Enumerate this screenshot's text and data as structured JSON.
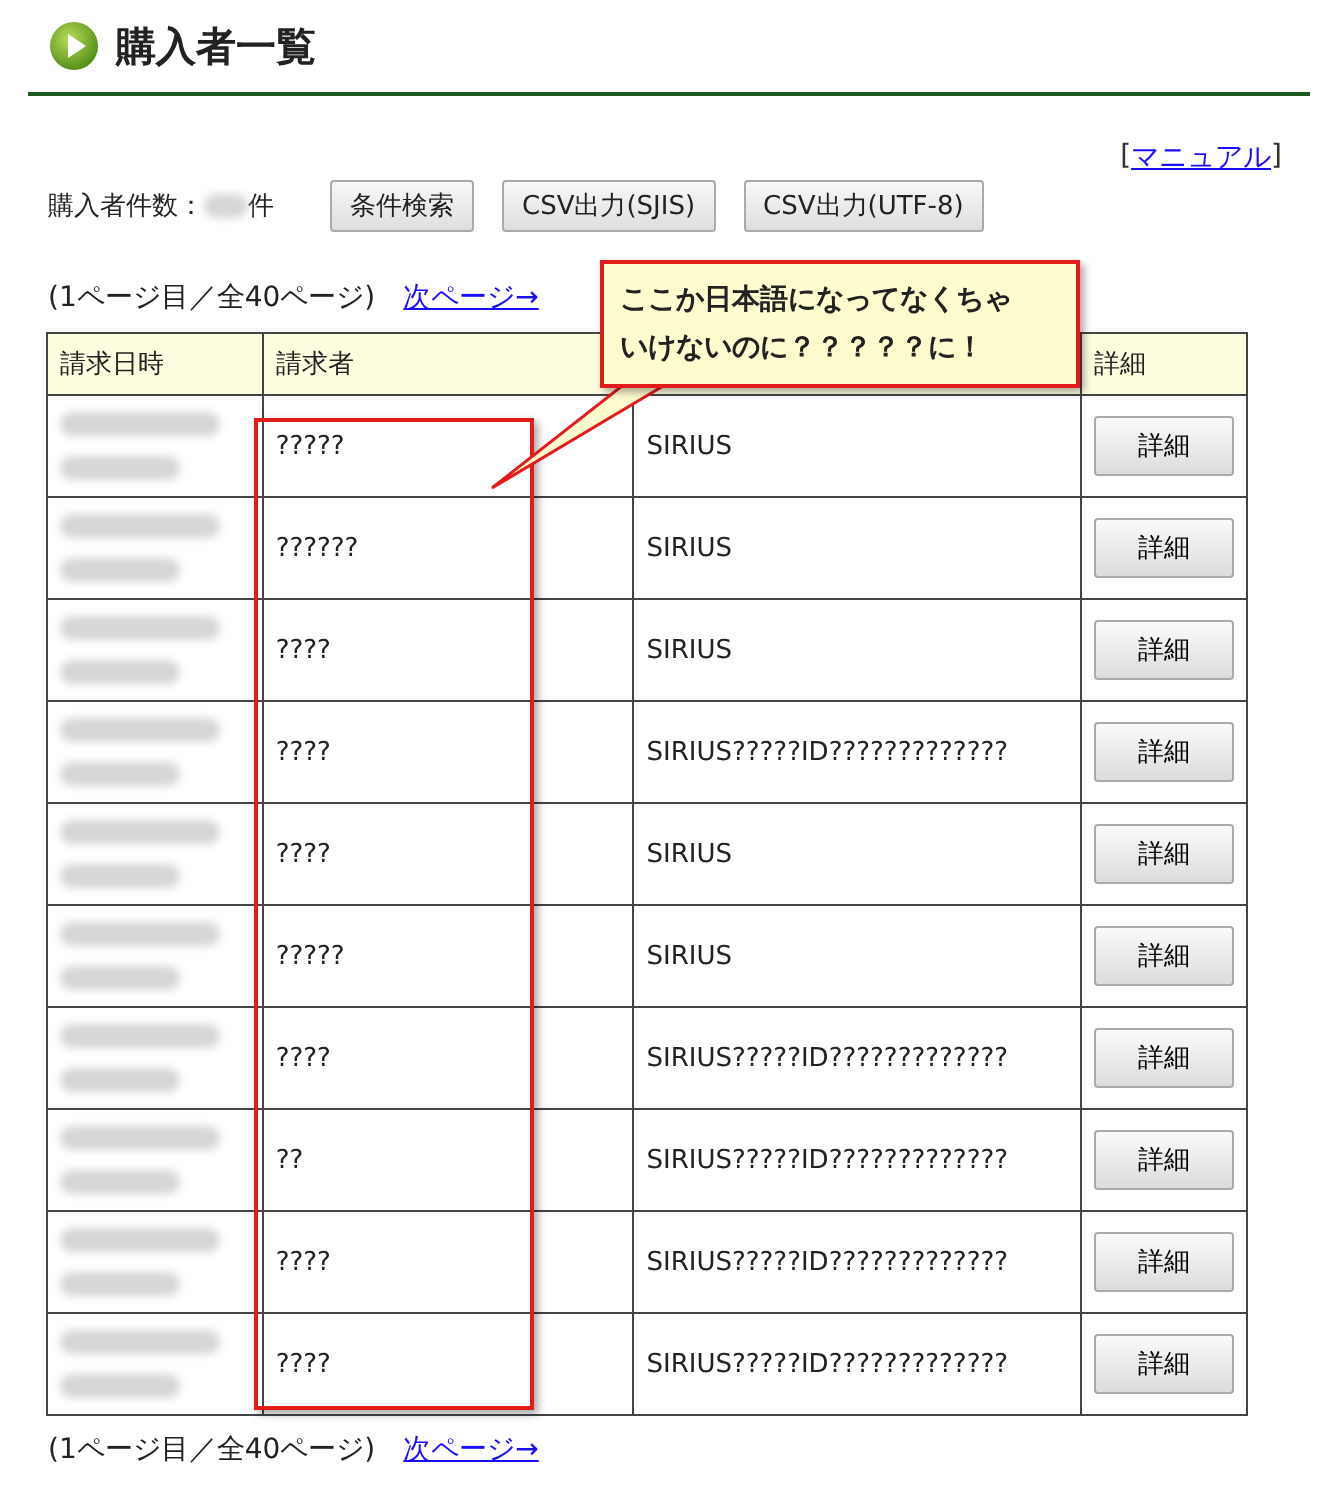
{
  "page_title": "購入者一覧",
  "manual_link": {
    "open": "[",
    "label": "マニュアル",
    "close": "]"
  },
  "count": {
    "label": "購入者件数：",
    "unit": "件"
  },
  "buttons": [
    "条件検索",
    "CSV出力(SJIS)",
    "CSV出力(UTF-8)"
  ],
  "pager_top": {
    "status": "(1ページ目／全40ページ)",
    "next": "次ページ→"
  },
  "table": {
    "columns": [
      {
        "label": "請求日時"
      },
      {
        "label": "請求者"
      },
      {},
      {
        "label": "詳細"
      }
    ],
    "rows": [
      {
        "requester": "?????",
        "product": "SIRIUS",
        "action": "詳細"
      },
      {
        "requester": "??????",
        "product": "SIRIUS",
        "action": "詳細"
      },
      {
        "requester": "????",
        "product": "SIRIUS",
        "action": "詳細"
      },
      {
        "requester": "????",
        "product": "SIRIUS?????ID?????????????",
        "action": "詳細"
      },
      {
        "requester": "????",
        "product": "SIRIUS",
        "action": "詳細"
      },
      {
        "requester": "?????",
        "product": "SIRIUS",
        "action": "詳細"
      },
      {
        "requester": "????",
        "product": "SIRIUS?????ID?????????????",
        "action": "詳細"
      },
      {
        "requester": "??",
        "product": "SIRIUS?????ID?????????????",
        "action": "詳細"
      },
      {
        "requester": "????",
        "product": "SIRIUS?????ID?????????????",
        "action": "詳細"
      },
      {
        "requester": "????",
        "product": "SIRIUS?????ID?????????????",
        "action": "詳細"
      }
    ]
  },
  "pager_bottom": {
    "status": "(1ページ目／全40ページ)",
    "next": "次ページ→"
  },
  "callout": {
    "lines": [
      "ここか日本語になってなくちゃ",
      "いけないのに？？？？？に！"
    ]
  }
}
